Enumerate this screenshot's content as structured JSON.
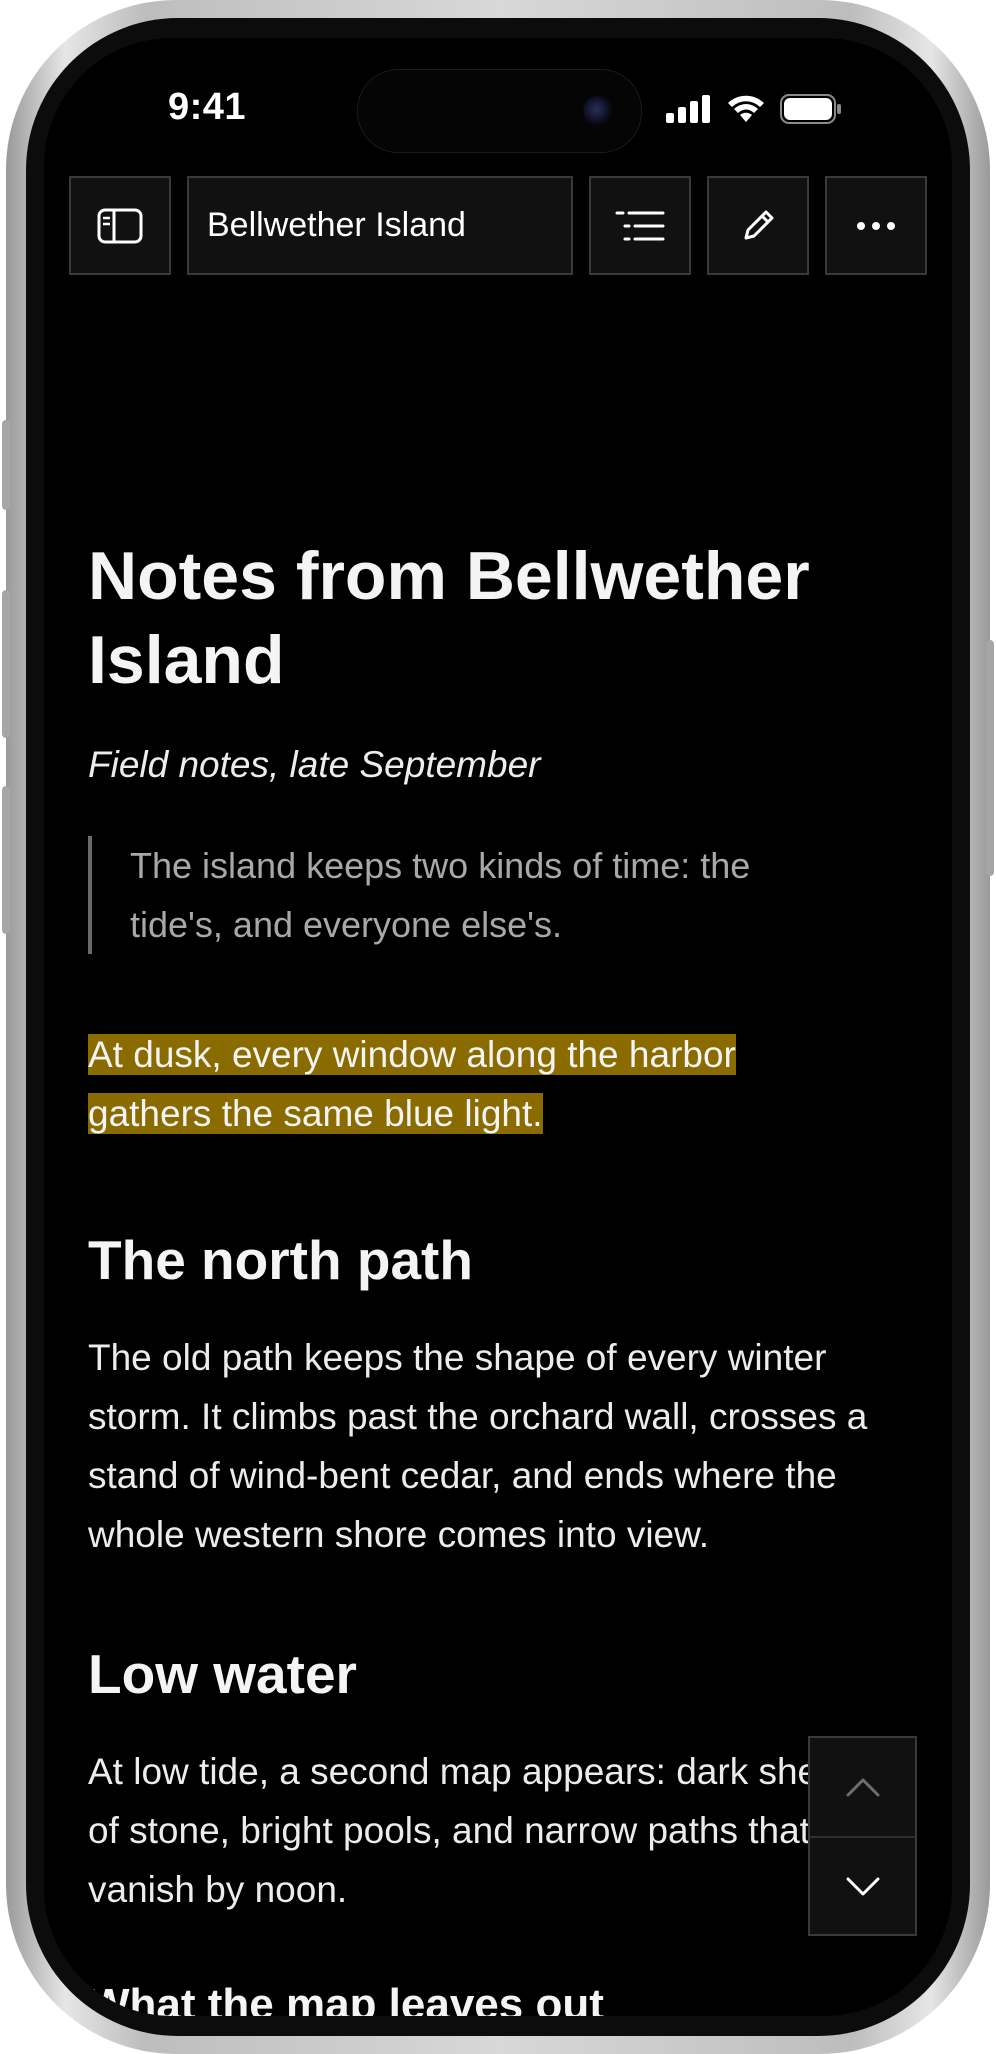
{
  "status_bar": {
    "time": "9:41"
  },
  "toolbar": {
    "document_title": "Bellwether Island"
  },
  "article": {
    "title": "Notes from Bellwether Island",
    "subtitle": "Field notes, late September",
    "quote": "The island keeps two kinds of time: the tide's, and everyone else's.",
    "highlighted_text": "At dusk, every window along the harbor gathers the same blue light.",
    "section_1_heading": "The north path",
    "section_1_body": "The old path keeps the shape of every winter storm. It climbs past the orchard wall, crosses a stand of wind-bent cedar, and ends where the whole western shore comes into view.",
    "section_2_heading": "Low water",
    "section_2_body": "At low tide, a second map appears: dark shelves of stone, bright pools, and narrow paths that vanish by noon.",
    "section_3_heading": "What the map leaves out"
  },
  "colors": {
    "background": "#000000",
    "highlight": "#8a6b00",
    "quote_text": "#a8a8a8"
  },
  "icons": [
    "sidebar-icon",
    "outline-list-icon",
    "pencil-icon",
    "more-icon",
    "chevron-up-icon",
    "chevron-down-icon"
  ]
}
